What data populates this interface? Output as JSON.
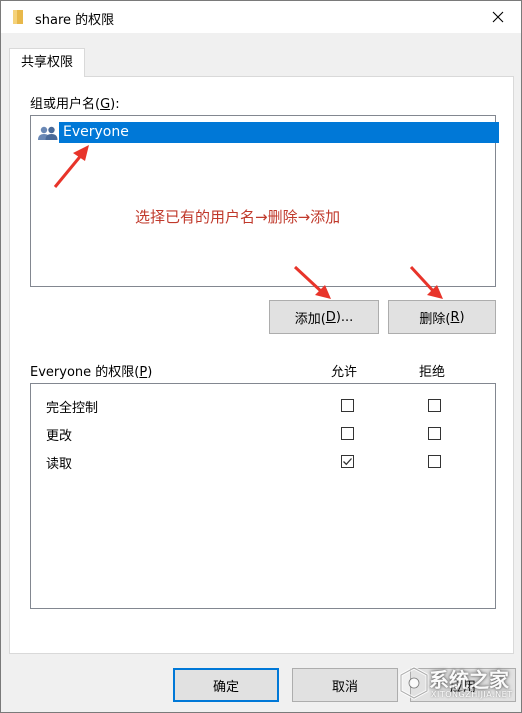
{
  "window": {
    "title": "share 的权限"
  },
  "tabs": [
    {
      "label": "共享权限"
    }
  ],
  "group": {
    "label_prefix": "组或用户名(",
    "label_key": "G",
    "label_suffix": "):",
    "users": [
      {
        "name": "Everyone",
        "selected": true
      }
    ],
    "annotation": "选择已有的用户名→删除→添加"
  },
  "buttons": {
    "add": {
      "prefix": "添加(",
      "key": "D",
      "suffix": ")..."
    },
    "remove": {
      "prefix": "删除(",
      "key": "R",
      "suffix": ")"
    },
    "ok": "确定",
    "cancel": "取消",
    "apply": "应用"
  },
  "permissions": {
    "label_prefix": "Everyone 的权限(",
    "label_key": "P",
    "label_suffix": ")",
    "allow_header": "允许",
    "deny_header": "拒绝",
    "rows": [
      {
        "name": "完全控制",
        "allow": false,
        "deny": false
      },
      {
        "name": "更改",
        "allow": false,
        "deny": false
      },
      {
        "name": "读取",
        "allow": true,
        "deny": false
      }
    ]
  },
  "watermark": {
    "text": "系统之家",
    "sub": "XITONGZHIJIA.NET"
  },
  "colors": {
    "selection": "#0078d7",
    "annotation": "#c0392b",
    "arrow": "#e8342a"
  }
}
